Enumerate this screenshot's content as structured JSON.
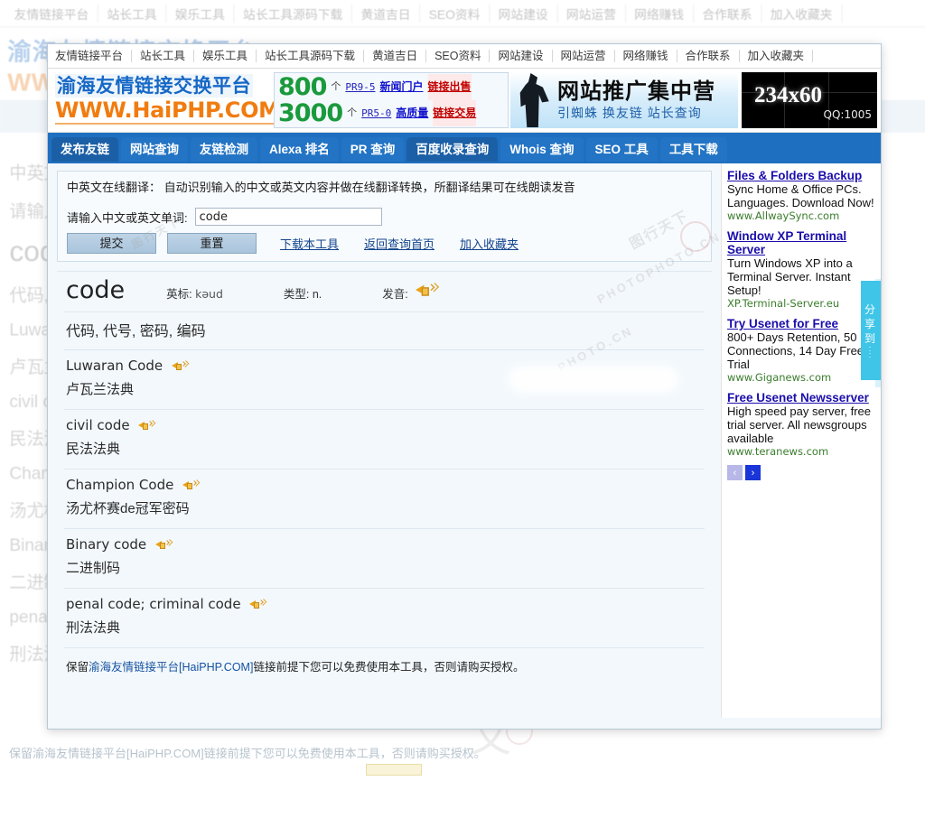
{
  "top_links": [
    "友情链接平台",
    "站长工具",
    "娱乐工具",
    "站长工具源码下载",
    "黄道吉日",
    "SEO资料",
    "网站建设",
    "网站运营",
    "网络赚钱",
    "合作联系",
    "加入收藏夹"
  ],
  "banner": {
    "logo_cn": "渝海友情链接交换平台",
    "logo_en": "WWW.HaiPHP.COM",
    "promo": [
      {
        "num": "800",
        "unit": "个",
        "pr": "PR9-5",
        "mid": "新闻门户",
        "red": "链接出售"
      },
      {
        "num": "3000",
        "unit": "个",
        "pr": "PR5-0",
        "mid": "高质量",
        "red": "链接交易"
      }
    ],
    "blue_banner_title": "网站推广集中营",
    "blue_banner_sub": "引蜘蛛 换友链 站长查询",
    "black_banner_size": "234x60",
    "black_banner_qq": "QQ:1005"
  },
  "nav_tabs": [
    {
      "label": "发布友链",
      "selected": true
    },
    {
      "label": "网站查询",
      "selected": false
    },
    {
      "label": "友链检测",
      "selected": false
    },
    {
      "label": "Alexa 排名",
      "selected": false
    },
    {
      "label": "PR 查询",
      "selected": false
    },
    {
      "label": "百度收录查询",
      "selected": true
    },
    {
      "label": "Whois 查询",
      "selected": false
    },
    {
      "label": "SEO 工具",
      "selected": false
    },
    {
      "label": "工具下载",
      "selected": false
    }
  ],
  "tool": {
    "intro": "中英文在线翻译： 自动识别输入的中文或英文内容并做在线翻译转换，所翻译结果可在线朗读发音",
    "input_label": "请输入中文或英文单词:",
    "input_value": "code",
    "input_placeholder": "",
    "submit_label": "提交",
    "reset_label": "重置",
    "links": [
      "下载本工具",
      "返回查询首页",
      "加入收藏夹"
    ]
  },
  "result": {
    "word": "code",
    "phonetic_label": "英标:",
    "phonetic_value": "kəud",
    "type_label": "类型:",
    "type_value": "n.",
    "sound_label": "发音:",
    "definition": "代码, 代号, 密码, 编码",
    "examples": [
      {
        "en": "Luwaran Code",
        "cn": "卢瓦兰法典"
      },
      {
        "en": "civil code",
        "cn": "民法法典"
      },
      {
        "en": "Champion Code",
        "cn": "汤尤杯赛de冠军密码"
      },
      {
        "en": "Binary code",
        "cn": "二进制码"
      },
      {
        "en": "penal code; criminal code",
        "cn": "刑法法典"
      }
    ]
  },
  "footer": {
    "pre": "保留",
    "link": "渝海友情链接平台[HaiPHP.COM]",
    "post": "链接前提下您可以免费使用本工具，否则请购买授权。"
  },
  "ads": [
    {
      "title": "Files & Folders Backup",
      "desc": "Sync Home & Office PCs. Languages. Download Now!",
      "url": "www.AllwaySync.com"
    },
    {
      "title": "Window XP Terminal Server",
      "desc": "Turn Windows XP into a Terminal Server. Instant Setup!",
      "url": "XP.Terminal-Server.eu"
    },
    {
      "title": "Try Usenet for Free",
      "desc": "800+ Days Retention, 50 Connections, 14 Day Free Trial",
      "url": "www.Giganews.com"
    },
    {
      "title": "Free Usenet Newsserver",
      "desc": "High speed pay server, free trial server. All newsgroups available",
      "url": "www.teranews.com"
    }
  ],
  "ad_nav": {
    "prev": "‹",
    "next": "›"
  },
  "share_widget": {
    "chars": [
      "分",
      "享",
      "到"
    ],
    "dots": ":"
  },
  "watermarks": [
    "图行天下",
    "PHOTOPHOTO.CN",
    "图行天下",
    "PHOTO.CN"
  ],
  "colors": {
    "accent_blue": "#1f6fc0",
    "logo_orange": "#f07c10",
    "promo_green": "#1a9a3c",
    "link_blue": "#1a0dab",
    "ad_url_green": "#3a7d2c",
    "share_cyan": "#3fc5e8"
  }
}
